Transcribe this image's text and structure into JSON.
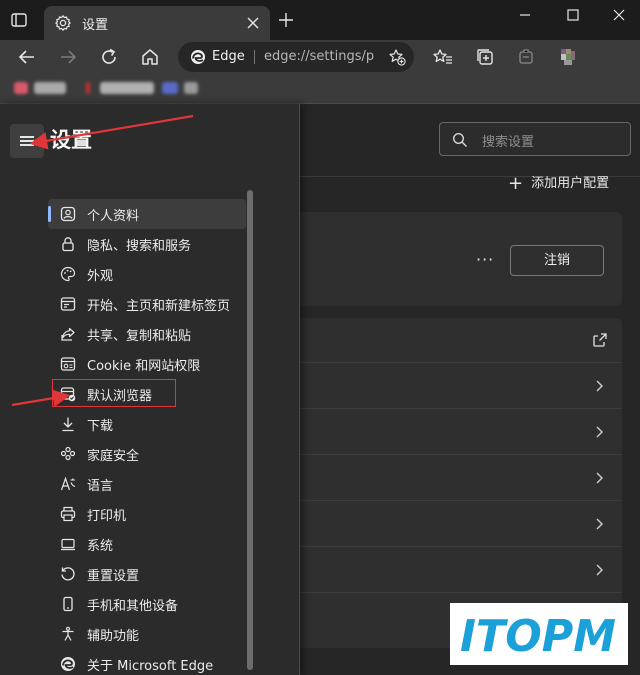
{
  "tab": {
    "title": "设置"
  },
  "address": {
    "site": "Edge",
    "url": "edge://settings/p..."
  },
  "page": {
    "title": "设置",
    "search_placeholder": "搜索设置",
    "add_profile": "添加用户配置",
    "more": "···",
    "signout": "注销"
  },
  "menu": {
    "items": [
      {
        "label": "个人资料",
        "icon": "profile-icon"
      },
      {
        "label": "隐私、搜索和服务",
        "icon": "lock-icon"
      },
      {
        "label": "外观",
        "icon": "palette-icon"
      },
      {
        "label": "开始、主页和新建标签页",
        "icon": "home-page-icon"
      },
      {
        "label": "共享、复制和粘贴",
        "icon": "share-icon"
      },
      {
        "label": "Cookie 和网站权限",
        "icon": "site-permissions-icon"
      },
      {
        "label": "默认浏览器",
        "icon": "default-browser-icon"
      },
      {
        "label": "下载",
        "icon": "download-icon"
      },
      {
        "label": "家庭安全",
        "icon": "family-icon"
      },
      {
        "label": "语言",
        "icon": "language-icon"
      },
      {
        "label": "打印机",
        "icon": "printer-icon"
      },
      {
        "label": "系统",
        "icon": "system-icon"
      },
      {
        "label": "重置设置",
        "icon": "reset-icon"
      },
      {
        "label": "手机和其他设备",
        "icon": "phone-icon"
      },
      {
        "label": "辅助功能",
        "icon": "accessibility-icon"
      },
      {
        "label": "关于 Microsoft Edge",
        "icon": "edge-logo-icon"
      }
    ]
  },
  "watermark": {
    "text": "ITOPM"
  },
  "colors": {
    "accent": "#8fb8ff",
    "annotation": "#e0363a",
    "watermark": "#1ba0d8"
  }
}
